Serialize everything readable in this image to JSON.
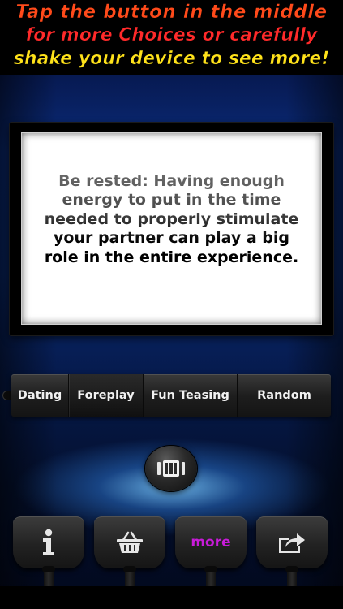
{
  "banner": {
    "line1": "Tap the button in the middle",
    "line2": "for more Choices or carefully",
    "line3": "shake your device to see more!"
  },
  "card": {
    "text": "Be rested: Having enough energy to put in the time needed to properly stimulate your partner can play a big role in the entire experience."
  },
  "categories": {
    "selected": "Foreplay",
    "items": [
      {
        "label": "Dating"
      },
      {
        "label": "Foreplay"
      },
      {
        "label": "Fun Teasing"
      },
      {
        "label": "Random"
      }
    ]
  },
  "center_button": {
    "icon": "shuffle-cards-icon"
  },
  "toolbar": {
    "info_icon": "info-icon",
    "basket_icon": "basket-icon",
    "more_label": "more",
    "more_color": "#c81bd8",
    "share_icon": "share-arrow-icon"
  }
}
